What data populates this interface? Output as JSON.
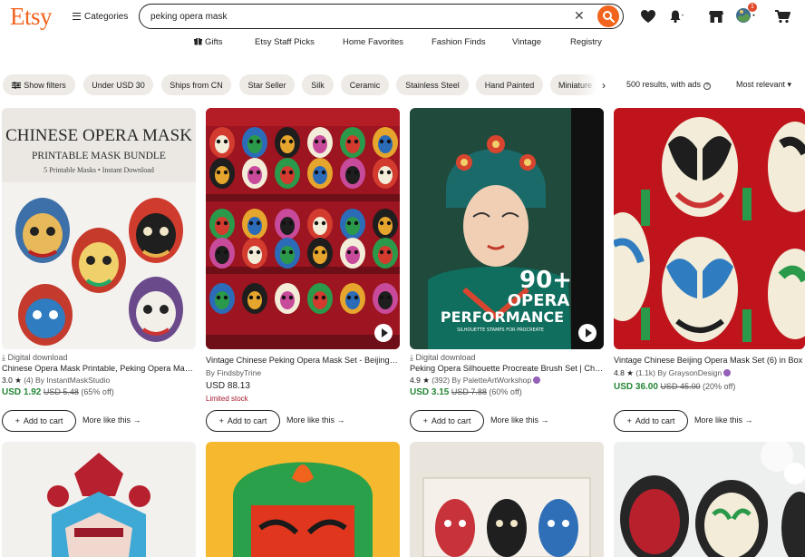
{
  "header": {
    "logo": "Etsy",
    "categories_label": "Categories",
    "search_value": "peking opera mask",
    "notification_count": "1"
  },
  "nav": [
    "Gifts",
    "Etsy Staff Picks",
    "Home Favorites",
    "Fashion Finds",
    "Vintage",
    "Registry"
  ],
  "filters": {
    "show_filters": "Show filters",
    "chips": [
      "Under USD 30",
      "Ships from CN",
      "Star Seller",
      "Silk",
      "Ceramic",
      "Stainless Steel",
      "Hand Painted",
      "Miniature"
    ],
    "results_text": "500 results, with ads",
    "sort_label": "Most relevant"
  },
  "listings": [
    {
      "download_label": "Digital download",
      "title": "Chinese Opera Mask Printable, Peking Opera Mask Bundle",
      "rating": "3.0",
      "reviews": "(4)",
      "by": "By InstantMaskStudio",
      "price": "USD 1.92",
      "original_price": "USD 5.48",
      "discount": "(65% off)",
      "image_title": "CHINESE OPERA MASK",
      "image_subtitle": "PRINTABLE MASK BUNDLE",
      "image_caption": "5 Printable Masks • Instant Download"
    },
    {
      "title": "Vintage Chinese Peking Opera Mask Set - Beijing Opera",
      "by": "By FindsbyTrine",
      "price": "USD 88.13",
      "stock_note": "Limited stock"
    },
    {
      "download_label": "Digital download",
      "title": "Peking Opera Silhouette Procreate Brush Set | Chinese Opera",
      "rating": "4.9",
      "reviews": "(392)",
      "by": "By PaletteArtWorkshop",
      "price": "USD 3.15",
      "original_price": "USD 7.88",
      "discount": "(60% off)",
      "image_big": "90+",
      "image_line1": "OPERA",
      "image_line2": "PERFORMANCE",
      "image_line3": "SILHOUETTE STAMPS FOR PROCREATE"
    },
    {
      "title": "Vintage Chinese Beijing Opera Mask Set (6) in Box",
      "rating": "4.8",
      "reviews": "(1.1k)",
      "by": "By GraysonDesign",
      "price": "USD 36.00",
      "original_price": "USD 45.00",
      "discount": "(20% off)"
    }
  ],
  "card_actions": {
    "add_to_cart": "Add to cart",
    "more_like_this": "More like this"
  },
  "colors": {
    "brand": "#f1641e",
    "sale_price": "#258635",
    "chip_bg": "#eeeae6",
    "limited_stock": "#a61a2e",
    "star_seller": "#9560b8"
  }
}
